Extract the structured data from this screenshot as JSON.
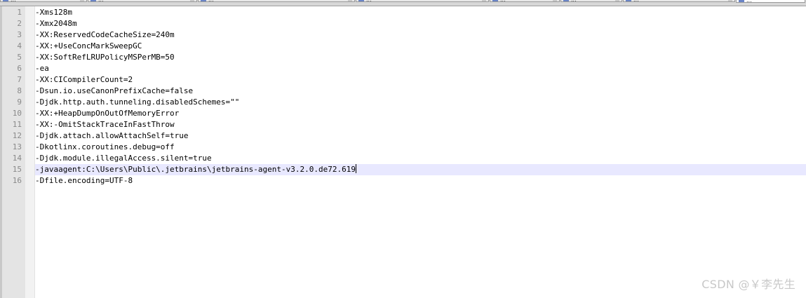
{
  "tabs": [
    {
      "label": "..."
    },
    {
      "label": "..."
    },
    {
      "label": "..."
    },
    {
      "label": "..."
    },
    {
      "label": "..."
    },
    {
      "label": "..."
    },
    {
      "label": "..."
    },
    {
      "label": "..."
    }
  ],
  "editor": {
    "lines": [
      {
        "number": "1",
        "text": "-Xms128m"
      },
      {
        "number": "2",
        "text": "-Xmx2048m"
      },
      {
        "number": "3",
        "text": "-XX:ReservedCodeCacheSize=240m"
      },
      {
        "number": "4",
        "text": "-XX:+UseConcMarkSweepGC"
      },
      {
        "number": "5",
        "text": "-XX:SoftRefLRUPolicyMSPerMB=50"
      },
      {
        "number": "6",
        "text": "-ea"
      },
      {
        "number": "7",
        "text": "-XX:CICompilerCount=2"
      },
      {
        "number": "8",
        "text": "-Dsun.io.useCanonPrefixCache=false"
      },
      {
        "number": "9",
        "text": "-Djdk.http.auth.tunneling.disabledSchemes=\"\""
      },
      {
        "number": "10",
        "text": "-XX:+HeapDumpOnOutOfMemoryError"
      },
      {
        "number": "11",
        "text": "-XX:-OmitStackTraceInFastThrow"
      },
      {
        "number": "12",
        "text": "-Djdk.attach.allowAttachSelf=true"
      },
      {
        "number": "13",
        "text": "-Dkotlinx.coroutines.debug=off"
      },
      {
        "number": "14",
        "text": "-Djdk.module.illegalAccess.silent=true"
      },
      {
        "number": "15",
        "text": "-javaagent:C:\\Users\\Public\\.jetbrains\\jetbrains-agent-v3.2.0.de72.619"
      },
      {
        "number": "16",
        "text": "-Dfile.encoding=UTF-8"
      }
    ],
    "current_line": 15
  },
  "watermark": "CSDN @￥李先生"
}
